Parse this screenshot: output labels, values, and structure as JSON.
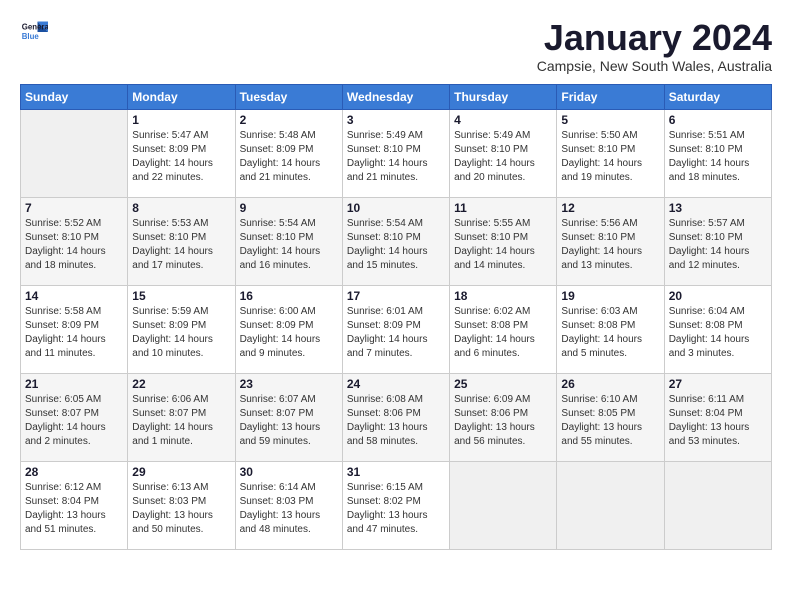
{
  "logo": {
    "line1": "General",
    "line2": "Blue"
  },
  "title": "January 2024",
  "location": "Campsie, New South Wales, Australia",
  "weekdays": [
    "Sunday",
    "Monday",
    "Tuesday",
    "Wednesday",
    "Thursday",
    "Friday",
    "Saturday"
  ],
  "weeks": [
    [
      {
        "day": "",
        "info": ""
      },
      {
        "day": "1",
        "info": "Sunrise: 5:47 AM\nSunset: 8:09 PM\nDaylight: 14 hours\nand 22 minutes."
      },
      {
        "day": "2",
        "info": "Sunrise: 5:48 AM\nSunset: 8:09 PM\nDaylight: 14 hours\nand 21 minutes."
      },
      {
        "day": "3",
        "info": "Sunrise: 5:49 AM\nSunset: 8:10 PM\nDaylight: 14 hours\nand 21 minutes."
      },
      {
        "day": "4",
        "info": "Sunrise: 5:49 AM\nSunset: 8:10 PM\nDaylight: 14 hours\nand 20 minutes."
      },
      {
        "day": "5",
        "info": "Sunrise: 5:50 AM\nSunset: 8:10 PM\nDaylight: 14 hours\nand 19 minutes."
      },
      {
        "day": "6",
        "info": "Sunrise: 5:51 AM\nSunset: 8:10 PM\nDaylight: 14 hours\nand 18 minutes."
      }
    ],
    [
      {
        "day": "7",
        "info": "Sunrise: 5:52 AM\nSunset: 8:10 PM\nDaylight: 14 hours\nand 18 minutes."
      },
      {
        "day": "8",
        "info": "Sunrise: 5:53 AM\nSunset: 8:10 PM\nDaylight: 14 hours\nand 17 minutes."
      },
      {
        "day": "9",
        "info": "Sunrise: 5:54 AM\nSunset: 8:10 PM\nDaylight: 14 hours\nand 16 minutes."
      },
      {
        "day": "10",
        "info": "Sunrise: 5:54 AM\nSunset: 8:10 PM\nDaylight: 14 hours\nand 15 minutes."
      },
      {
        "day": "11",
        "info": "Sunrise: 5:55 AM\nSunset: 8:10 PM\nDaylight: 14 hours\nand 14 minutes."
      },
      {
        "day": "12",
        "info": "Sunrise: 5:56 AM\nSunset: 8:10 PM\nDaylight: 14 hours\nand 13 minutes."
      },
      {
        "day": "13",
        "info": "Sunrise: 5:57 AM\nSunset: 8:10 PM\nDaylight: 14 hours\nand 12 minutes."
      }
    ],
    [
      {
        "day": "14",
        "info": "Sunrise: 5:58 AM\nSunset: 8:09 PM\nDaylight: 14 hours\nand 11 minutes."
      },
      {
        "day": "15",
        "info": "Sunrise: 5:59 AM\nSunset: 8:09 PM\nDaylight: 14 hours\nand 10 minutes."
      },
      {
        "day": "16",
        "info": "Sunrise: 6:00 AM\nSunset: 8:09 PM\nDaylight: 14 hours\nand 9 minutes."
      },
      {
        "day": "17",
        "info": "Sunrise: 6:01 AM\nSunset: 8:09 PM\nDaylight: 14 hours\nand 7 minutes."
      },
      {
        "day": "18",
        "info": "Sunrise: 6:02 AM\nSunset: 8:08 PM\nDaylight: 14 hours\nand 6 minutes."
      },
      {
        "day": "19",
        "info": "Sunrise: 6:03 AM\nSunset: 8:08 PM\nDaylight: 14 hours\nand 5 minutes."
      },
      {
        "day": "20",
        "info": "Sunrise: 6:04 AM\nSunset: 8:08 PM\nDaylight: 14 hours\nand 3 minutes."
      }
    ],
    [
      {
        "day": "21",
        "info": "Sunrise: 6:05 AM\nSunset: 8:07 PM\nDaylight: 14 hours\nand 2 minutes."
      },
      {
        "day": "22",
        "info": "Sunrise: 6:06 AM\nSunset: 8:07 PM\nDaylight: 14 hours\nand 1 minute."
      },
      {
        "day": "23",
        "info": "Sunrise: 6:07 AM\nSunset: 8:07 PM\nDaylight: 13 hours\nand 59 minutes."
      },
      {
        "day": "24",
        "info": "Sunrise: 6:08 AM\nSunset: 8:06 PM\nDaylight: 13 hours\nand 58 minutes."
      },
      {
        "day": "25",
        "info": "Sunrise: 6:09 AM\nSunset: 8:06 PM\nDaylight: 13 hours\nand 56 minutes."
      },
      {
        "day": "26",
        "info": "Sunrise: 6:10 AM\nSunset: 8:05 PM\nDaylight: 13 hours\nand 55 minutes."
      },
      {
        "day": "27",
        "info": "Sunrise: 6:11 AM\nSunset: 8:04 PM\nDaylight: 13 hours\nand 53 minutes."
      }
    ],
    [
      {
        "day": "28",
        "info": "Sunrise: 6:12 AM\nSunset: 8:04 PM\nDaylight: 13 hours\nand 51 minutes."
      },
      {
        "day": "29",
        "info": "Sunrise: 6:13 AM\nSunset: 8:03 PM\nDaylight: 13 hours\nand 50 minutes."
      },
      {
        "day": "30",
        "info": "Sunrise: 6:14 AM\nSunset: 8:03 PM\nDaylight: 13 hours\nand 48 minutes."
      },
      {
        "day": "31",
        "info": "Sunrise: 6:15 AM\nSunset: 8:02 PM\nDaylight: 13 hours\nand 47 minutes."
      },
      {
        "day": "",
        "info": ""
      },
      {
        "day": "",
        "info": ""
      },
      {
        "day": "",
        "info": ""
      }
    ]
  ]
}
